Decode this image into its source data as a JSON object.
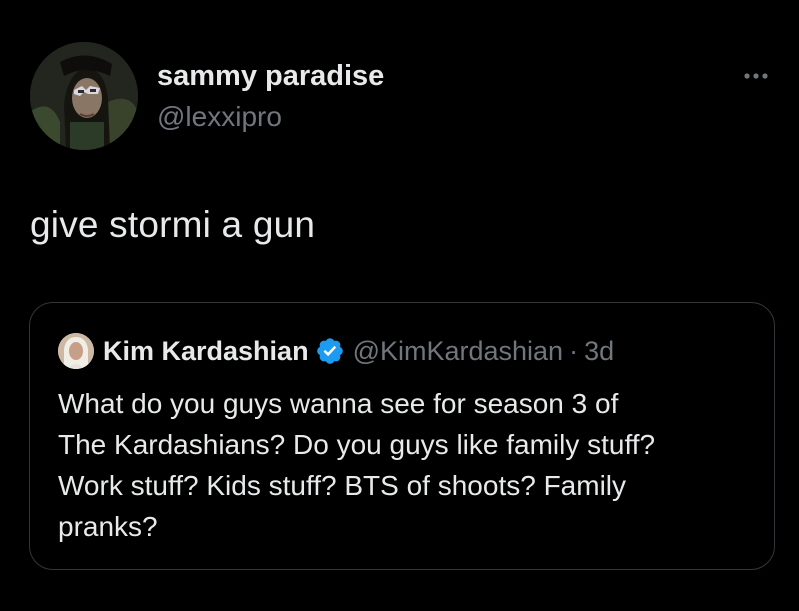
{
  "tweet": {
    "author": {
      "display_name": "sammy paradise",
      "handle": "@lexxipro",
      "avatar_icon": "profile-photo"
    },
    "more_icon": "more-dots-icon",
    "text": "give stormi a gun"
  },
  "quoted_tweet": {
    "author": {
      "display_name": "Kim Kardashian",
      "handle": "@KimKardashian",
      "verified": true,
      "verified_icon": "verified-badge-icon",
      "avatar_icon": "profile-photo"
    },
    "separator": "·",
    "timestamp": "3d",
    "text_lines": [
      "What do you guys wanna see for season 3 of",
      "The Kardashians? Do you guys like family stuff?",
      "Work stuff? Kids stuff? BTS of shoots? Family",
      "pranks?"
    ]
  },
  "colors": {
    "background": "#000000",
    "primary_text": "#e7e9ea",
    "secondary_text": "#71767b",
    "border": "#333639",
    "verified_blue": "#1d9bf0"
  }
}
